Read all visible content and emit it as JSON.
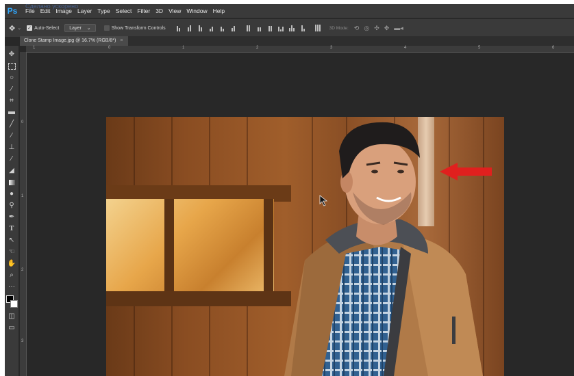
{
  "app": {
    "logo": "Ps",
    "watermark": "Сделано ускорено",
    "menu": [
      "File",
      "Edit",
      "Image",
      "Layer",
      "Type",
      "Select",
      "Filter",
      "3D",
      "View",
      "Window",
      "Help"
    ]
  },
  "options": {
    "auto_select_label": "Auto-Select",
    "auto_select_checked": true,
    "layer_select_value": "Layer",
    "show_transform_label": "Show Transform Controls",
    "show_transform_checked": false,
    "mode_3d_label": "3D Mode:"
  },
  "document": {
    "tab_title": "Clone Stamp Image.jpg @ 16.7% (RGB/8*)",
    "close_glyph": "×"
  },
  "rulers": {
    "top_ticks": [
      "1",
      "0",
      "1",
      "2",
      "3",
      "4",
      "5",
      "6"
    ],
    "left_ticks": [
      "0",
      "1",
      "2",
      "3"
    ]
  },
  "tools": [
    {
      "name": "move-tool",
      "icon": "move-icon"
    },
    {
      "name": "marquee-tool",
      "icon": "marquee-icon"
    },
    {
      "name": "lasso-tool",
      "icon": "lasso-icon"
    },
    {
      "name": "quick-select-tool",
      "icon": "wand-icon"
    },
    {
      "name": "crop-tool",
      "icon": "crop-icon"
    },
    {
      "name": "frame-tool",
      "icon": "frame-icon"
    },
    {
      "name": "eyedropper-tool",
      "icon": "eyedropper-icon"
    },
    {
      "name": "healing-brush-tool",
      "icon": "bandage-icon"
    },
    {
      "name": "brush-tool",
      "icon": "brush-icon"
    },
    {
      "name": "clone-stamp-tool",
      "icon": "stamp-icon"
    },
    {
      "name": "history-brush-tool",
      "icon": "history-brush-icon"
    },
    {
      "name": "eraser-tool",
      "icon": "eraser-icon"
    },
    {
      "name": "gradient-tool",
      "icon": "gradient-icon"
    },
    {
      "name": "blur-tool",
      "icon": "drop-icon"
    },
    {
      "name": "dodge-tool",
      "icon": "dodge-icon"
    },
    {
      "name": "pen-tool",
      "icon": "pen-icon"
    },
    {
      "name": "type-tool",
      "icon": "type-icon"
    },
    {
      "name": "path-select-tool",
      "icon": "arrow-select-icon"
    },
    {
      "name": "shape-tool",
      "icon": "shape-icon"
    },
    {
      "name": "hand-tool",
      "icon": "hand-icon"
    },
    {
      "name": "zoom-tool",
      "icon": "zoom-icon"
    },
    {
      "name": "more-tools",
      "icon": "ellipsis-icon"
    }
  ],
  "colors": {
    "app_bg": "#282828",
    "panel_bg": "#3a3a3a",
    "ps_blue": "#31a8ff",
    "arrow_red": "#e0201e"
  }
}
